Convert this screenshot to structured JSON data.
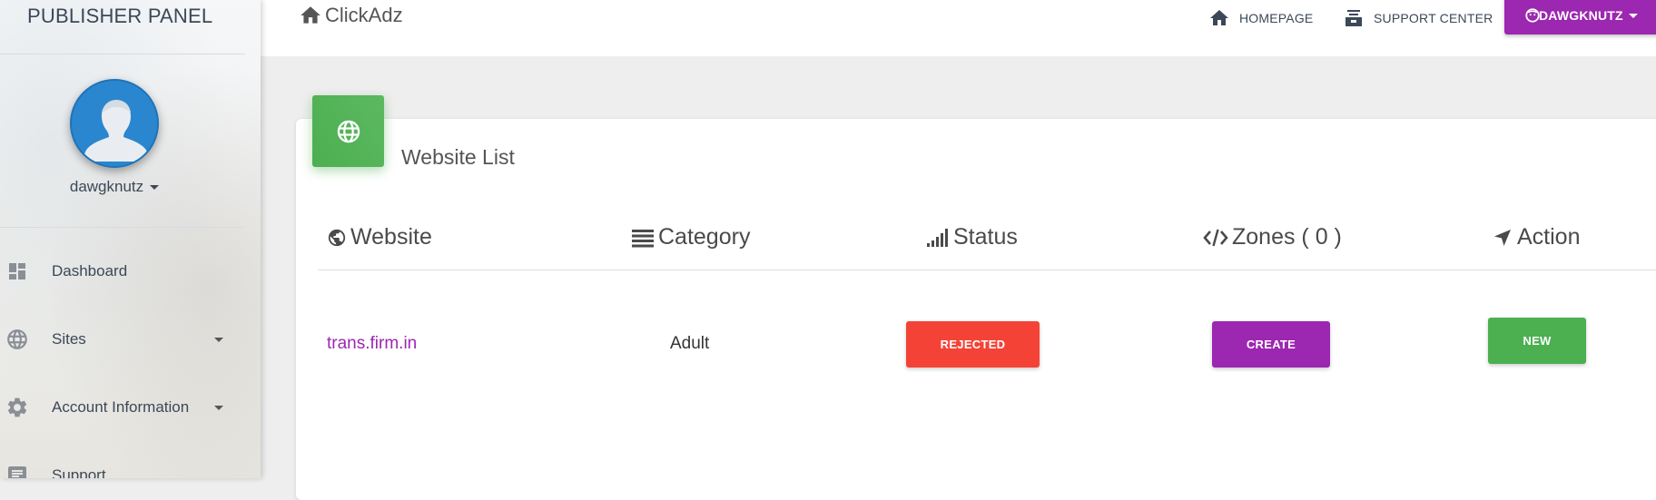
{
  "sidebar": {
    "brand": "PUBLISHER PANEL",
    "username": "dawgknutz",
    "items": [
      {
        "label": "Dashboard",
        "icon": "dashboard-icon",
        "has_caret": false
      },
      {
        "label": "Sites",
        "icon": "globe-icon",
        "has_caret": true
      },
      {
        "label": "Account Information",
        "icon": "gear-icon",
        "has_caret": true
      },
      {
        "label": "Support",
        "icon": "support-icon",
        "has_caret": false
      }
    ]
  },
  "topbar": {
    "app_title": "ClickAdz",
    "homepage": "HOMEPAGE",
    "support_center": "SUPPORT CENTER",
    "user_button": "DAWGKNUTZ"
  },
  "card": {
    "title": "Website List",
    "columns": {
      "website": "Website",
      "category": "Category",
      "status": "Status",
      "zones": "Zones ( 0 )",
      "action": "Action"
    },
    "rows": [
      {
        "website": "trans.firm.in",
        "category": "Adult",
        "status": "REJECTED",
        "zones_button": "CREATE",
        "action_button": "NEW"
      }
    ]
  },
  "colors": {
    "primary_purple": "#9c27b0",
    "success_green": "#4caf50",
    "danger_red": "#f44336",
    "link_purple": "#9c27b0"
  }
}
